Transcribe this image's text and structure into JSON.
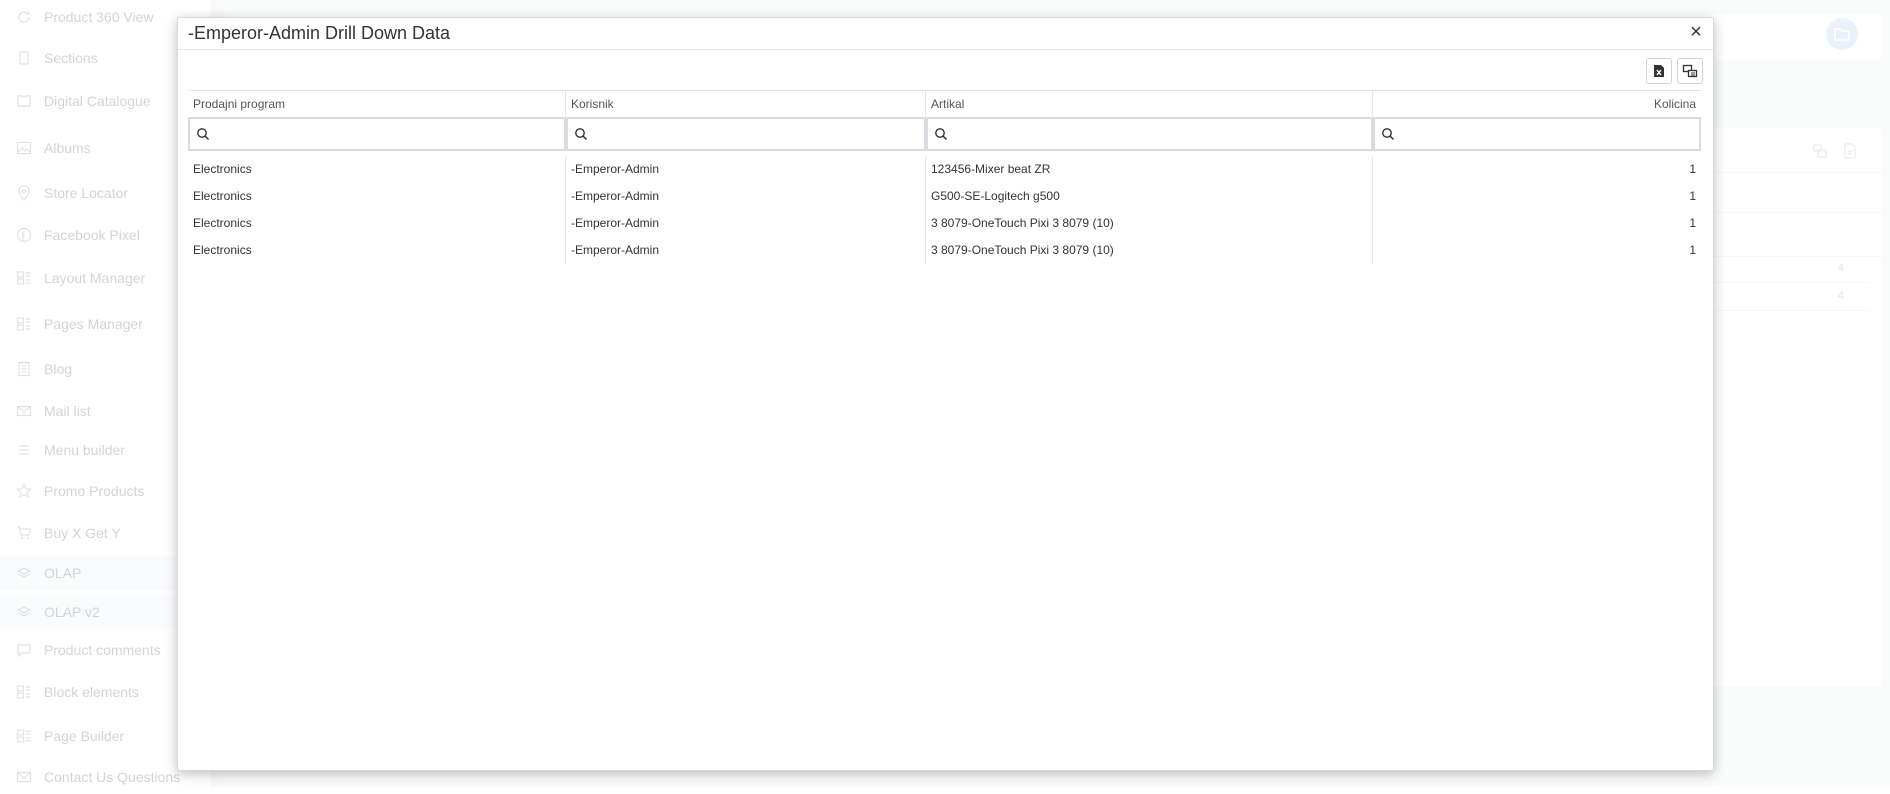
{
  "sidebar": {
    "items": [
      {
        "label": "Product 360 View",
        "icon": "refresh-icon",
        "active": false
      },
      {
        "label": "Sections",
        "icon": "page-icon",
        "active": false
      },
      {
        "label": "Digital Catalogue",
        "icon": "book-icon",
        "active": false
      },
      {
        "label": "Albums",
        "icon": "image-icon",
        "active": false
      },
      {
        "label": "Store Locator",
        "icon": "location-icon",
        "active": false
      },
      {
        "label": "Facebook Pixel",
        "icon": "facebook-icon",
        "active": false
      },
      {
        "label": "Layout Manager",
        "icon": "layout-icon",
        "active": false
      },
      {
        "label": "Pages Manager",
        "icon": "layout-icon",
        "active": false
      },
      {
        "label": "Blog",
        "icon": "blog-icon",
        "active": false
      },
      {
        "label": "Mail list",
        "icon": "mail-icon",
        "active": false
      },
      {
        "label": "Menu builder",
        "icon": "menu-icon",
        "active": false
      },
      {
        "label": "Promo Products",
        "icon": "star-icon",
        "active": false
      },
      {
        "label": "Buy X Get Y",
        "icon": "cart-icon",
        "active": false
      },
      {
        "label": "OLAP",
        "icon": "layers-icon",
        "active": true
      },
      {
        "label": "OLAP v2",
        "icon": "layers-icon",
        "active": true
      },
      {
        "label": "Product comments",
        "icon": "comment-icon",
        "active": false
      },
      {
        "label": "Block elements",
        "icon": "layout-icon",
        "active": false
      },
      {
        "label": "Page Builder",
        "icon": "layout-icon",
        "active": false
      },
      {
        "label": "Contact Us Questions",
        "icon": "mail-icon",
        "active": false
      }
    ]
  },
  "background": {
    "row_values": [
      "4",
      "4"
    ]
  },
  "modal": {
    "title": "-Emperor-Admin Drill Down Data",
    "close_label": "×",
    "toolbar": {
      "export_excel_icon": "excel-export-icon",
      "column_chooser_icon": "column-chooser-icon"
    },
    "columns": [
      "Prodajni program",
      "Korisnik",
      "Artikal",
      "Kolicina"
    ],
    "filters": [
      "",
      "",
      "",
      ""
    ],
    "rows": [
      {
        "program": "Electronics",
        "user": "-Emperor-Admin",
        "item": "123456-Mixer beat ZR",
        "qty": "1"
      },
      {
        "program": "Electronics",
        "user": "-Emperor-Admin",
        "item": "G500-SE-Logitech g500",
        "qty": "1"
      },
      {
        "program": "Electronics",
        "user": "-Emperor-Admin",
        "item": "3 8079-OneTouch Pixi 3 8079 (10)",
        "qty": "1"
      },
      {
        "program": "Electronics",
        "user": "-Emperor-Admin",
        "item": "3 8079-OneTouch Pixi 3 8079 (10)",
        "qty": "1"
      }
    ]
  }
}
